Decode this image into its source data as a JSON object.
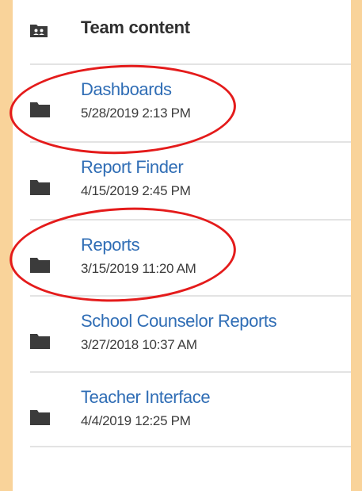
{
  "header": {
    "title": "Team content",
    "icon": "team-folder-icon"
  },
  "items": [
    {
      "name": "Dashboards",
      "date": "5/28/2019 2:13 PM",
      "icon": "folder-icon",
      "highlighted": true
    },
    {
      "name": "Report Finder",
      "date": "4/15/2019 2:45 PM",
      "icon": "folder-icon",
      "highlighted": false
    },
    {
      "name": "Reports",
      "date": "3/15/2019 11:20 AM",
      "icon": "folder-icon",
      "highlighted": true
    },
    {
      "name": "School Counselor Reports",
      "date": "3/27/2018 10:37 AM",
      "icon": "folder-icon",
      "highlighted": false
    },
    {
      "name": "Teacher Interface",
      "date": "4/4/2019 12:25 PM",
      "icon": "folder-icon",
      "highlighted": false
    }
  ],
  "colors": {
    "link": "#2f6db5",
    "annotation": "#e41b1b",
    "background": "#f9d39a"
  }
}
